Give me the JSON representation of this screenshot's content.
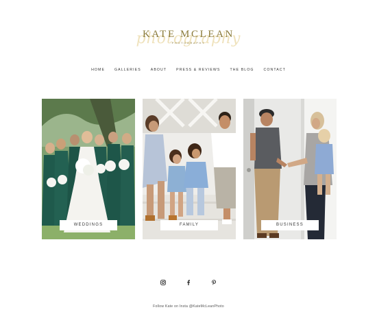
{
  "logo": {
    "name": "KATE MCLEAN",
    "subtitle": "PHOTOGRAPHY",
    "script": "photography"
  },
  "nav": {
    "items": [
      "HOME",
      "GALLERIES",
      "ABOUT",
      "PRESS & REVIEWS",
      "THE BLOG",
      "CONTACT"
    ]
  },
  "galleries": [
    {
      "label": "WEDDINGS"
    },
    {
      "label": "FAMILY"
    },
    {
      "label": "BUSINESS"
    }
  ],
  "social": {
    "icons": [
      "instagram-icon",
      "facebook-icon",
      "pinterest-icon"
    ],
    "follow_text": "Follow Kate on Insta @KateMcLeanPhoto"
  },
  "colors": {
    "logo_gold": "#8a7a3a",
    "logo_script": "#ead9a6"
  }
}
